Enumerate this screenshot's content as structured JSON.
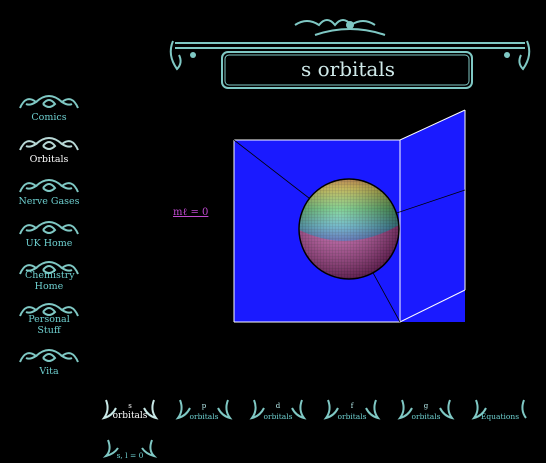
{
  "header": {
    "title": "s orbitals"
  },
  "sidebar": {
    "items": [
      {
        "label": "Comics"
      },
      {
        "label": "Orbitals",
        "active": true
      },
      {
        "label": "Nerve Gases"
      },
      {
        "label": "UK Home"
      },
      {
        "label": "Chemistry Home"
      },
      {
        "label": "Personal Stuff"
      },
      {
        "label": "Vita"
      }
    ]
  },
  "plot": {
    "ml_link": "mℓ = 0",
    "sphere": "s-orbital-sphere",
    "box_color": "#1a1aff"
  },
  "bottom_nav": {
    "items": [
      {
        "symbol": "s",
        "label": "orbitals",
        "active": true
      },
      {
        "symbol": "p",
        "label": "orbitals"
      },
      {
        "symbol": "d",
        "label": "orbitals"
      },
      {
        "symbol": "f",
        "label": "orbitals"
      },
      {
        "symbol": "g",
        "label": "orbitals"
      },
      {
        "symbol": "",
        "label": "Equations"
      }
    ],
    "extra": {
      "label": "s, l = 0"
    }
  },
  "colors": {
    "accent": "#6ed0d0",
    "ornament": "#7fc8c4",
    "link": "#c04ad0"
  }
}
